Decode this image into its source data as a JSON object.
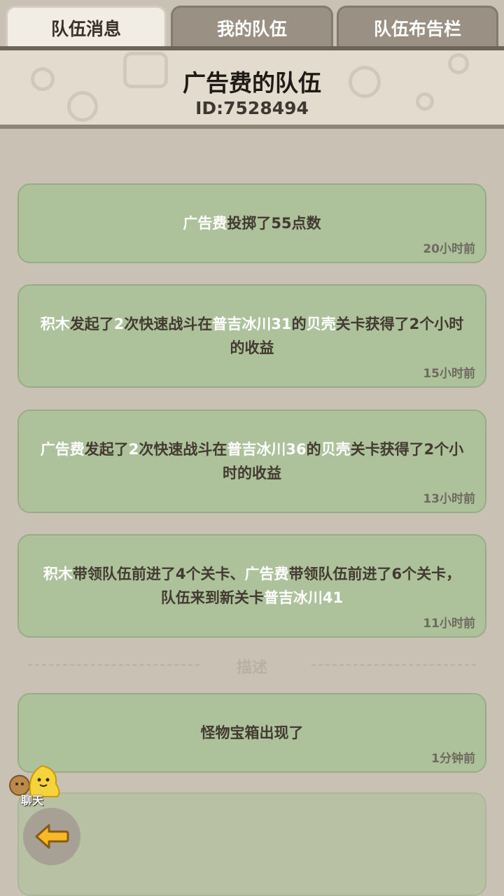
{
  "tabs": [
    {
      "label": "队伍消息",
      "active": true
    },
    {
      "label": "我的队伍",
      "active": false
    },
    {
      "label": "队伍布告栏",
      "active": false
    }
  ],
  "header": {
    "team_name": "广告费的队伍",
    "team_id": "ID:7528494"
  },
  "messages": [
    {
      "parts": [
        {
          "text": "广告费",
          "highlight": true
        },
        {
          "text": "投掷了55点数",
          "highlight": false
        }
      ],
      "time": "20小时前"
    },
    {
      "parts": [
        {
          "text": "积木",
          "highlight": true
        },
        {
          "text": "发起了",
          "highlight": false
        },
        {
          "text": "2",
          "highlight": true
        },
        {
          "text": "次快速战斗在",
          "highlight": false
        },
        {
          "text": "普吉冰川31",
          "highlight": true
        },
        {
          "text": "的",
          "highlight": false
        },
        {
          "text": "贝壳",
          "highlight": true
        },
        {
          "text": "关卡获得了2个小时的收益",
          "highlight": false
        }
      ],
      "time": "15小时前"
    },
    {
      "parts": [
        {
          "text": "广告费",
          "highlight": true
        },
        {
          "text": "发起了",
          "highlight": false
        },
        {
          "text": "2",
          "highlight": true
        },
        {
          "text": "次快速战斗在",
          "highlight": false
        },
        {
          "text": "普吉冰川36",
          "highlight": true
        },
        {
          "text": "的",
          "highlight": false
        },
        {
          "text": "贝壳",
          "highlight": true
        },
        {
          "text": "关卡获得了2个小时的收益",
          "highlight": false
        }
      ],
      "time": "13小时前"
    },
    {
      "parts": [
        {
          "text": "积木",
          "highlight": true
        },
        {
          "text": "带领队伍前进了4个关卡、",
          "highlight": false
        },
        {
          "text": "广告费",
          "highlight": true
        },
        {
          "text": "带领队伍前进了6个关卡，队伍来到新关卡",
          "highlight": false
        },
        {
          "text": "普吉冰川41",
          "highlight": true
        }
      ],
      "time": "11小时前"
    }
  ],
  "divider": {
    "label": "描述"
  },
  "description_messages": [
    {
      "text": "怪物宝箱出现了",
      "time": "1分钟前"
    }
  ],
  "chat": {
    "label": "聊天"
  },
  "colors": {
    "background": "#c9c1b3",
    "card": "#adc19b",
    "highlight_text": "#ffffff",
    "body_text": "#433a31"
  }
}
